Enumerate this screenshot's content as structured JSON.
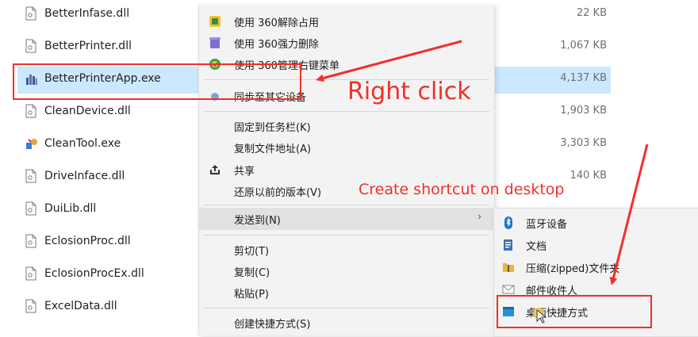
{
  "files": [
    {
      "name": "BetterInfase.dll",
      "size": "22 KB",
      "type": "dll"
    },
    {
      "name": "BetterPrinter.dll",
      "size": "1,067 KB",
      "type": "dll"
    },
    {
      "name": "BetterPrinterApp.exe",
      "size": "4,137 KB",
      "type": "exe",
      "selected": true
    },
    {
      "name": "CleanDevice.dll",
      "size": "1,903 KB",
      "type": "dll"
    },
    {
      "name": "CleanTool.exe",
      "size": "3,303 KB",
      "type": "exe"
    },
    {
      "name": "DriveInface.dll",
      "size": "140 KB",
      "type": "dll"
    },
    {
      "name": "DuiLib.dll",
      "size": "",
      "type": "dll"
    },
    {
      "name": "EclosionProc.dll",
      "size": "",
      "type": "dll"
    },
    {
      "name": "EclosionProcEx.dll",
      "size": "",
      "type": "dll"
    },
    {
      "name": "ExcelData.dll",
      "size": "",
      "type": "dll"
    }
  ],
  "context_menu": {
    "items": [
      {
        "label": "使用 360解除占用",
        "icon": "360-unlock-icon"
      },
      {
        "label": "使用 360强力删除",
        "icon": "360-delete-icon"
      },
      {
        "label": "使用 360管理右键菜单",
        "icon": "360-manage-icon"
      },
      {
        "label": "同步至其它设备",
        "icon": "sync-icon"
      },
      {
        "label": "固定到任务栏(K)"
      },
      {
        "label": "复制文件地址(A)"
      },
      {
        "label": "共享",
        "icon": "share-icon"
      },
      {
        "label": "还原以前的版本(V)"
      },
      {
        "label": "发送到(N)"
      },
      {
        "label": "剪切(T)"
      },
      {
        "label": "复制(C)"
      },
      {
        "label": "粘贴(P)"
      },
      {
        "label": "创建快捷方式(S)"
      }
    ],
    "submenu_arrow": "›"
  },
  "send_to_submenu": {
    "items": [
      {
        "label": "蓝牙设备",
        "icon": "bluetooth-icon"
      },
      {
        "label": "文档",
        "icon": "document-icon"
      },
      {
        "label": "压缩(zipped)文件夹",
        "icon": "zip-folder-icon"
      },
      {
        "label": "邮件收件人",
        "icon": "mail-icon"
      },
      {
        "label": "桌面快捷方式",
        "icon": "desktop-icon"
      }
    ]
  },
  "annotations": {
    "right_click": "Right click",
    "create_shortcut": "Create shortcut on desktop",
    "color": "#f0302a"
  },
  "colors": {
    "selection": "#cce8ff",
    "menu_bg": "#f3f3f3",
    "hover": "#e1e1e1",
    "annotation_red": "#f0302a"
  }
}
